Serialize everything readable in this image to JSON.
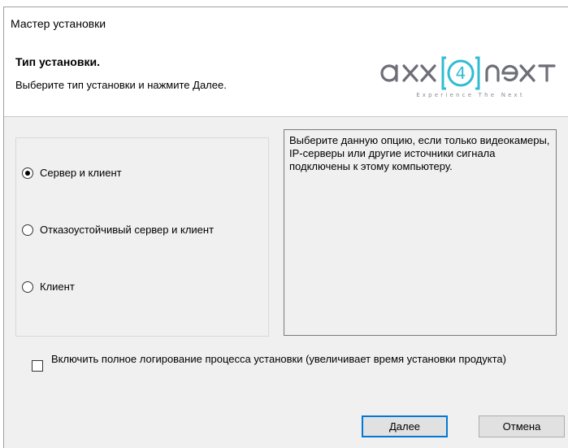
{
  "window": {
    "title": "Мастер установки"
  },
  "header": {
    "heading": "Тип установки.",
    "subheading": "Выберите тип установки и нажмите Далее.",
    "logo": {
      "wordmark": "axxon next",
      "tagline": "Experience The Next",
      "accent_color": "#2fbcd3"
    }
  },
  "options": [
    {
      "label": "Сервер и клиент",
      "checked": true
    },
    {
      "label": "Отказоустойчивый сервер и клиент",
      "checked": false
    },
    {
      "label": "Клиент",
      "checked": false
    }
  ],
  "description": "Выберите данную опцию, если только видеокамеры, IP-серверы или другие источники сигнала подключены к этому компьютеру.",
  "logging": {
    "label": "Включить полное логирование процесса установки (увеличивает время установки продукта)",
    "checked": false
  },
  "buttons": {
    "next": "Далее",
    "cancel": "Отмена"
  },
  "colors": {
    "primary_border": "#0078d7",
    "dialog_bg": "#f0f0f0"
  }
}
